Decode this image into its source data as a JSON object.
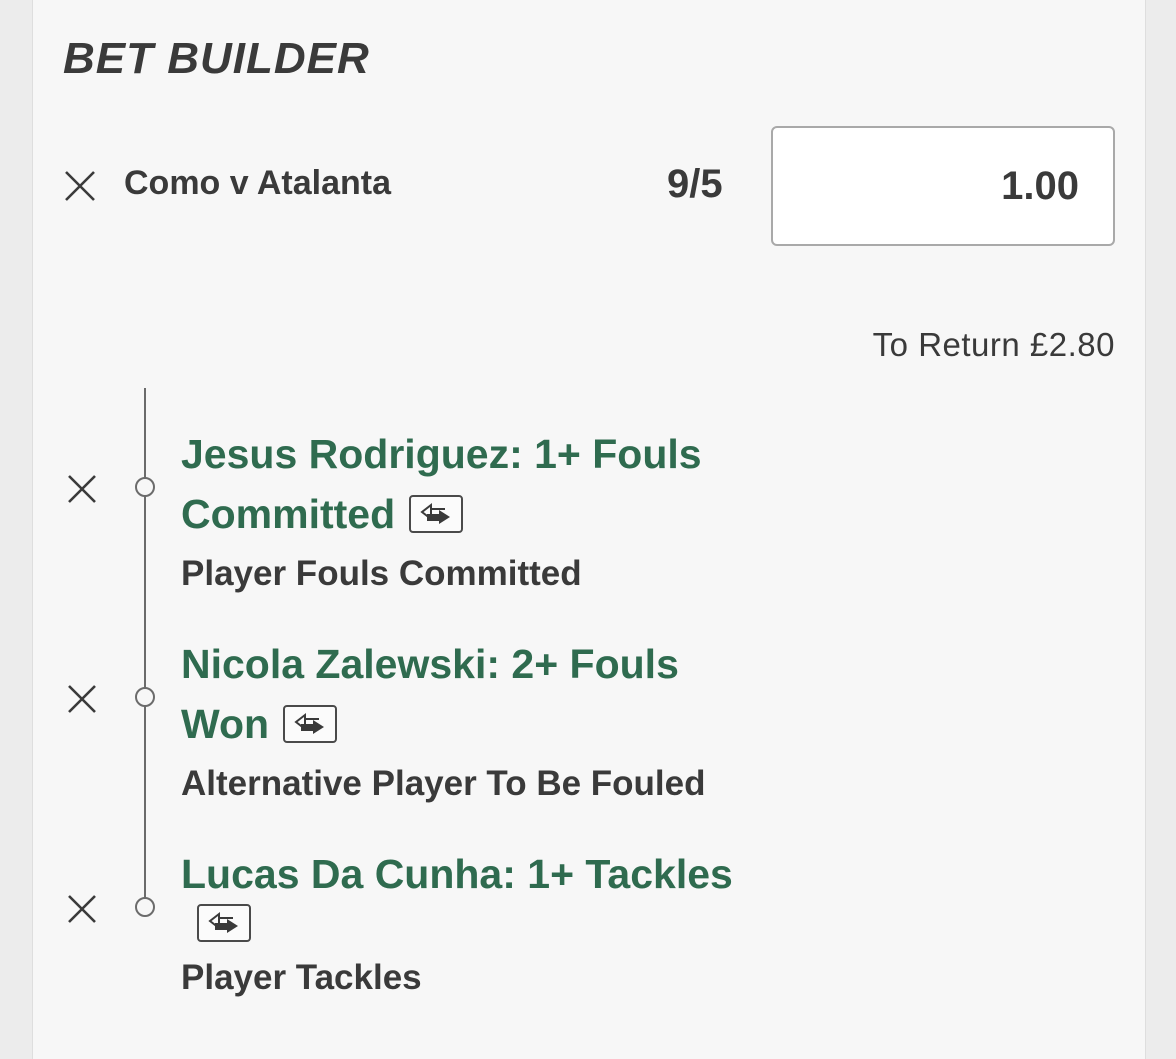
{
  "header": {
    "title": "BET BUILDER"
  },
  "bet": {
    "match": "Como v Atalanta",
    "odds": "9/5",
    "stake": "1.00",
    "to_return": "To Return £2.80"
  },
  "selections": [
    {
      "name_line1": "Jesus Rodriguez: 1+ Fouls",
      "name_line2": "Committed",
      "market": "Player Fouls Committed",
      "icon": "swap-icon"
    },
    {
      "name_line1": "Nicola Zalewski: 2+ Fouls",
      "name_line2": "Won",
      "market": "Alternative Player To Be Fouled",
      "icon": "swap-icon"
    },
    {
      "name_line1": "Lucas Da Cunha: 1+ Tackles",
      "name_line2": "",
      "market": "Player Tackles",
      "icon": "swap-icon"
    }
  ],
  "colors": {
    "selection_green": "#2f6b4f",
    "text_dark": "#3a3a3a",
    "background": "#f7f7f7"
  }
}
